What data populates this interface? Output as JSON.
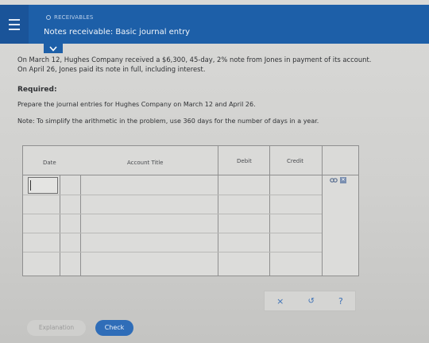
{
  "header": {
    "topic": "RECEIVABLES",
    "title": "Notes receivable: Basic journal entry"
  },
  "problem": {
    "line1": "On March 12, Hughes Company received a $6,300, 45-day, 2% note from Jones in payment of its account.",
    "line2": "On April 26, Jones paid its note in full, including interest.",
    "required_label": "Required:",
    "instruction": "Prepare the journal entries for Hughes Company on March 12 and April 26.",
    "note": "Note: To simplify the arithmetic in the problem, use 360 days for the number of days in a year."
  },
  "journal": {
    "columns": [
      "Date",
      "Account Title",
      "Debit",
      "Credit"
    ]
  },
  "actions": {
    "clear": "×",
    "undo": "↺",
    "help": "?"
  },
  "buttons": {
    "explanation": "Explanation",
    "check": "Check"
  },
  "colors": {
    "header": "#1d5fa8",
    "accent": "#2f6db8"
  }
}
